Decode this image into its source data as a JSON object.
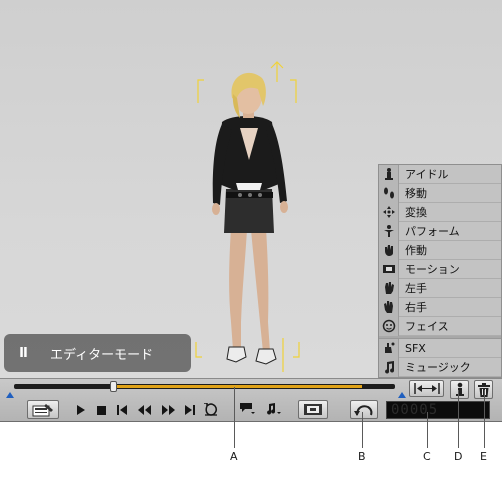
{
  "mode_badge": {
    "pause_symbol": "II",
    "label": "エディターモード"
  },
  "motion_menu": {
    "items": [
      {
        "label": "アイドル",
        "icon": "idle-figure-icon"
      },
      {
        "label": "移動",
        "icon": "footprints-icon"
      },
      {
        "label": "変換",
        "icon": "transform-arrows-icon"
      },
      {
        "label": "パフォーム",
        "icon": "perform-figure-icon"
      },
      {
        "label": "作動",
        "icon": "action-hand-icon"
      },
      {
        "label": "モーション",
        "icon": "motion-film-icon"
      },
      {
        "label": "左手",
        "icon": "left-hand-icon"
      },
      {
        "label": "右手",
        "icon": "right-hand-icon"
      },
      {
        "label": "フェイス",
        "icon": "face-icon"
      },
      {
        "label": "SFX",
        "icon": "sfx-hand-icon"
      },
      {
        "label": "ミュージック",
        "icon": "music-note-icon"
      }
    ]
  },
  "timeline": {
    "playhead_position": 0.26,
    "colors": {
      "fill": "#e0a319",
      "track": "#1d1d1d",
      "markers": "#1f5fbf"
    }
  },
  "counter": {
    "value": "00005"
  },
  "callouts": [
    "A",
    "B",
    "C",
    "D",
    "E"
  ]
}
